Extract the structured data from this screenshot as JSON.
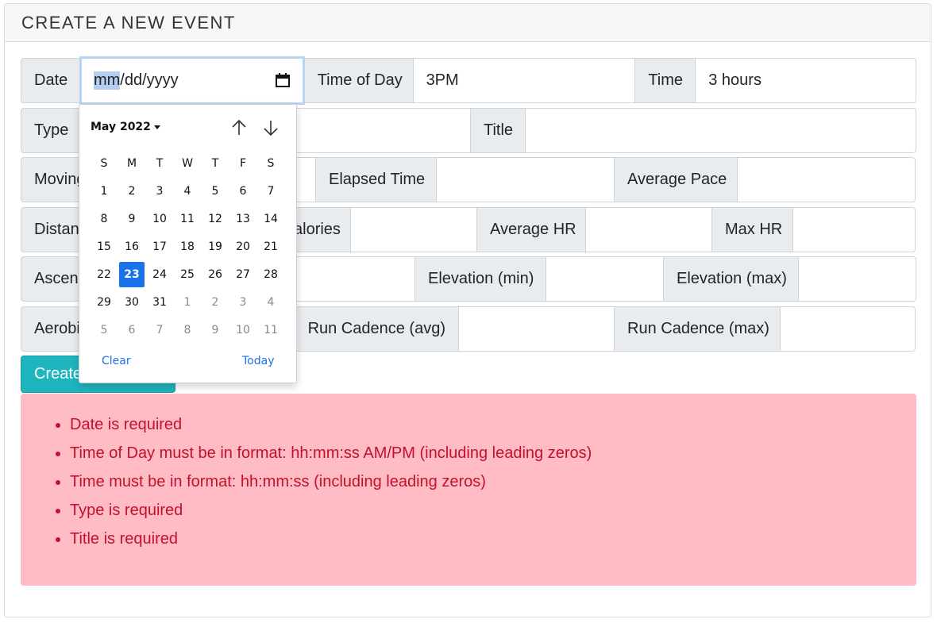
{
  "card": {
    "title": "CREATE A NEW EVENT"
  },
  "form": {
    "row1": {
      "date_label": "Date",
      "date_placeholder_highlight": "mm",
      "date_placeholder_rest": "/dd/yyyy",
      "time_of_day_label": "Time of Day",
      "time_of_day_value": "3PM",
      "time_label": "Time",
      "time_value": "3 hours"
    },
    "row2": {
      "type_label": "Type",
      "title_label": "Title"
    },
    "row3": {
      "moving_label": "Moving",
      "elapsed_label": "Elapsed Time",
      "pace_label": "Average Pace"
    },
    "row4": {
      "distance_label": "Distan",
      "calories_label": "alories",
      "avg_hr_label": "Average HR",
      "max_hr_label": "Max HR"
    },
    "row5": {
      "ascent_label": "Ascent",
      "elev_min_label": "Elevation (min)",
      "elev_max_label": "Elevation (max)"
    },
    "row6": {
      "aerobic_label": "Aerobi",
      "cadence_avg_label": "Run Cadence (avg)",
      "cadence_max_label": "Run Cadence (max)"
    },
    "submit_label": "Create"
  },
  "datepicker": {
    "month_label": "May 2022",
    "weekdays": [
      "S",
      "M",
      "T",
      "W",
      "T",
      "F",
      "S"
    ],
    "weeks": [
      [
        1,
        2,
        3,
        4,
        5,
        6,
        7
      ],
      [
        8,
        9,
        10,
        11,
        12,
        13,
        14
      ],
      [
        15,
        16,
        17,
        18,
        19,
        20,
        21
      ],
      [
        22,
        23,
        24,
        25,
        26,
        27,
        28
      ],
      [
        29,
        30,
        31,
        1,
        2,
        3,
        4
      ],
      [
        5,
        6,
        7,
        8,
        9,
        10,
        11
      ]
    ],
    "selected_day": 23,
    "clear_label": "Clear",
    "today_label": "Today"
  },
  "errors": [
    "Date is required",
    "Time of Day must be in format: hh:mm:ss AM/PM (including leading zeros)",
    "Time must be in format: hh:mm:ss (including leading zeros)",
    "Type is required",
    "Title is required"
  ],
  "colors": {
    "accent": "#1fb5bf",
    "selected_day": "#1a73e8",
    "alert_bg": "#ffbcc4",
    "alert_text": "#c4102a"
  }
}
